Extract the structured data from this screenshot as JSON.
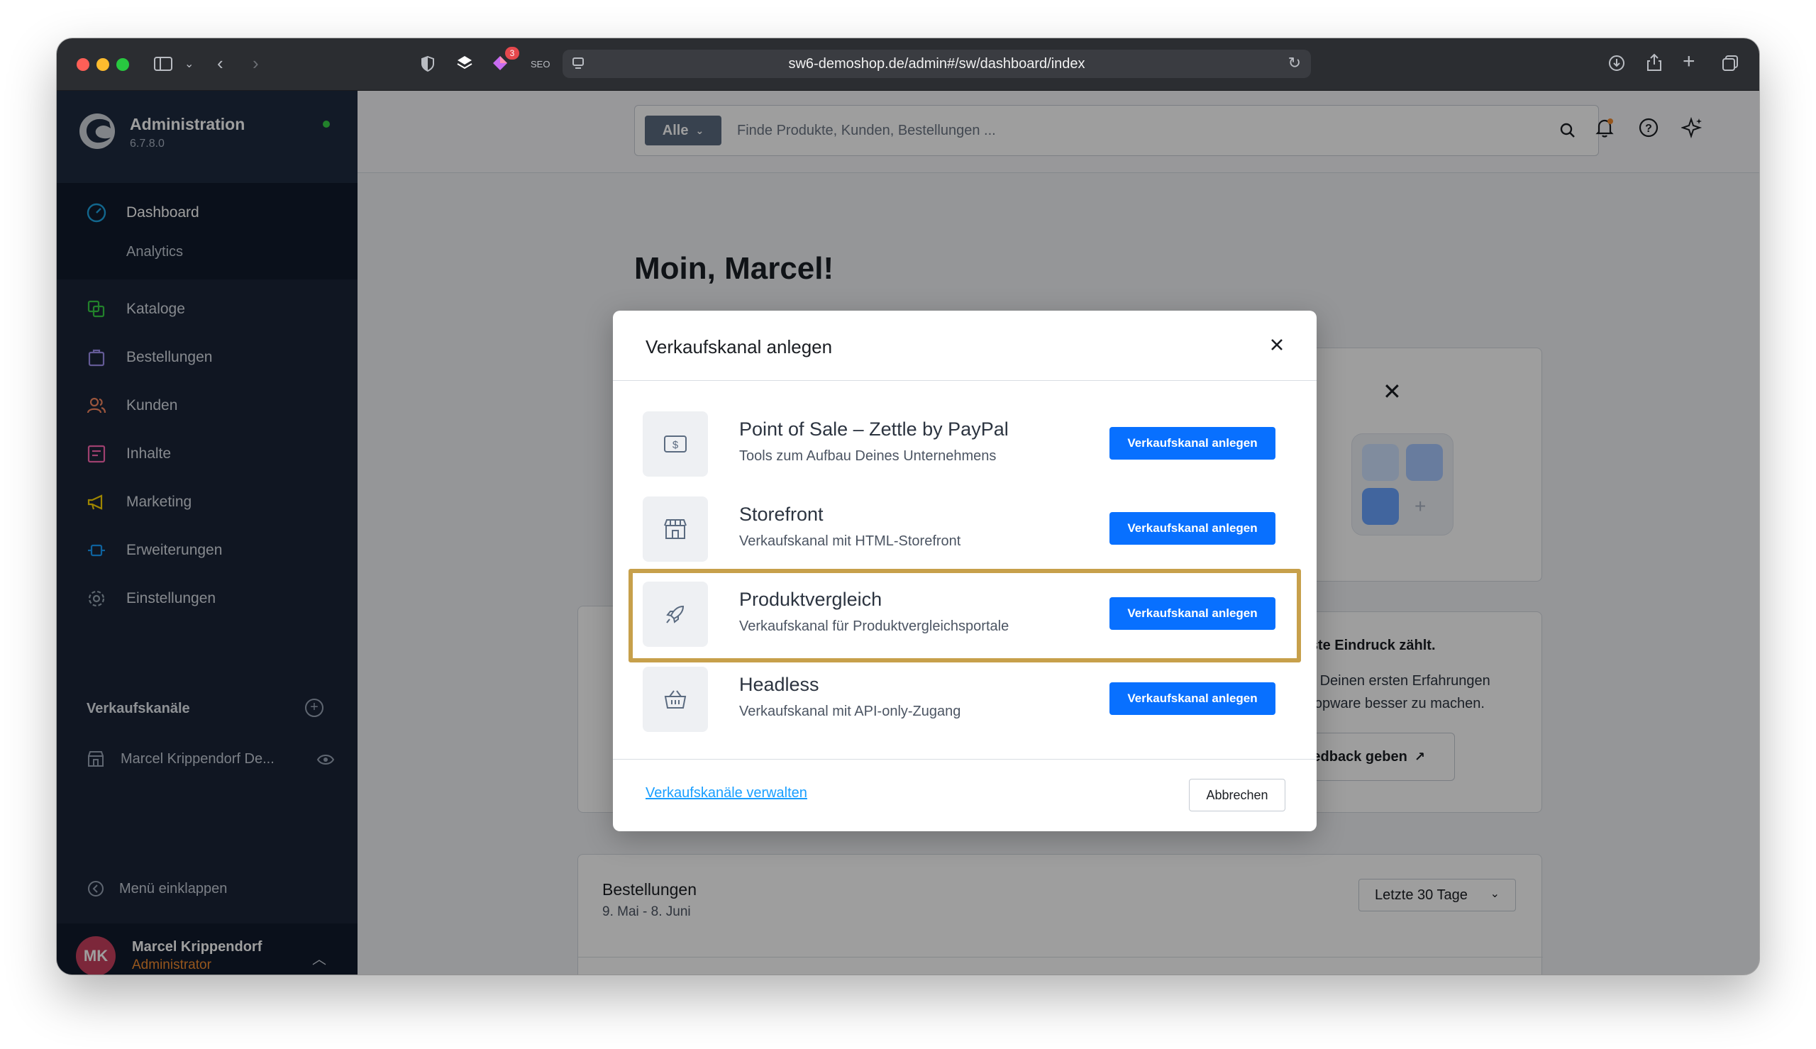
{
  "browser": {
    "url": "sw6-demoshop.de/admin#/sw/dashboard/index",
    "seo_label": "SEO",
    "extension_badge": "3"
  },
  "brand": {
    "title": "Administration",
    "version": "6.7.8.0"
  },
  "nav": {
    "dashboard": "Dashboard",
    "analytics": "Analytics",
    "items": [
      {
        "label": "Kataloge",
        "icon": "catalog-icon",
        "color": "#37d046"
      },
      {
        "label": "Bestellungen",
        "icon": "shopping-bag-icon",
        "color": "#a092f0"
      },
      {
        "label": "Kunden",
        "icon": "users-icon",
        "color": "#f88962"
      },
      {
        "label": "Inhalte",
        "icon": "content-icon",
        "color": "#ff68b4"
      },
      {
        "label": "Marketing",
        "icon": "megaphone-icon",
        "color": "#ffd700"
      },
      {
        "label": "Erweiterungen",
        "icon": "plugin-icon",
        "color": "#189eff"
      },
      {
        "label": "Einstellungen",
        "icon": "gear-icon",
        "color": "#9aa8b5"
      }
    ]
  },
  "sales_channels": {
    "title": "Verkaufskanäle",
    "items": [
      {
        "label": "Marcel Krippendorf De..."
      }
    ]
  },
  "collapse_label": "Menü einklappen",
  "user": {
    "initials": "MK",
    "name": "Marcel Krippendorf",
    "role": "Administrator"
  },
  "search": {
    "scope": "Alle",
    "placeholder": "Finde Produkte, Kunden, Bestellungen ..."
  },
  "dashboard": {
    "greeting": "Moin, Marcel!",
    "feedback_title": "Der erste Eindruck zählt.",
    "feedback_text_1": "uns von Deinen ersten Erfahrungen",
    "feedback_text_2": "uns, Shopware besser zu machen.",
    "feedback_button": "Feedback geben",
    "orders_title": "Bestellungen",
    "orders_range": "9. Mai - 8. Juni",
    "orders_filter": "Letzte 30 Tage"
  },
  "modal": {
    "title": "Verkaufskanal anlegen",
    "rows": [
      {
        "title": "Point of Sale – Zettle by PayPal",
        "desc": "Tools zum Aufbau Deines Unternehmens",
        "button": "Verkaufskanal anlegen",
        "icon": "cash-register-icon"
      },
      {
        "title": "Storefront",
        "desc": "Verkaufskanal mit HTML-Storefront",
        "button": "Verkaufskanal anlegen",
        "icon": "storefront-icon"
      },
      {
        "title": "Produktvergleich",
        "desc": "Verkaufskanal für Produktvergleichsportale",
        "button": "Verkaufskanal anlegen",
        "icon": "rocket-icon"
      },
      {
        "title": "Headless",
        "desc": "Verkaufskanal mit API-only-Zugang",
        "button": "Verkaufskanal anlegen",
        "icon": "basket-icon"
      }
    ],
    "manage_link": "Verkaufskanäle verwalten",
    "cancel": "Abbrechen"
  },
  "colors": {
    "primary": "#0870ff",
    "highlight": "#c7a04b",
    "sidebar": "#1a2538"
  }
}
